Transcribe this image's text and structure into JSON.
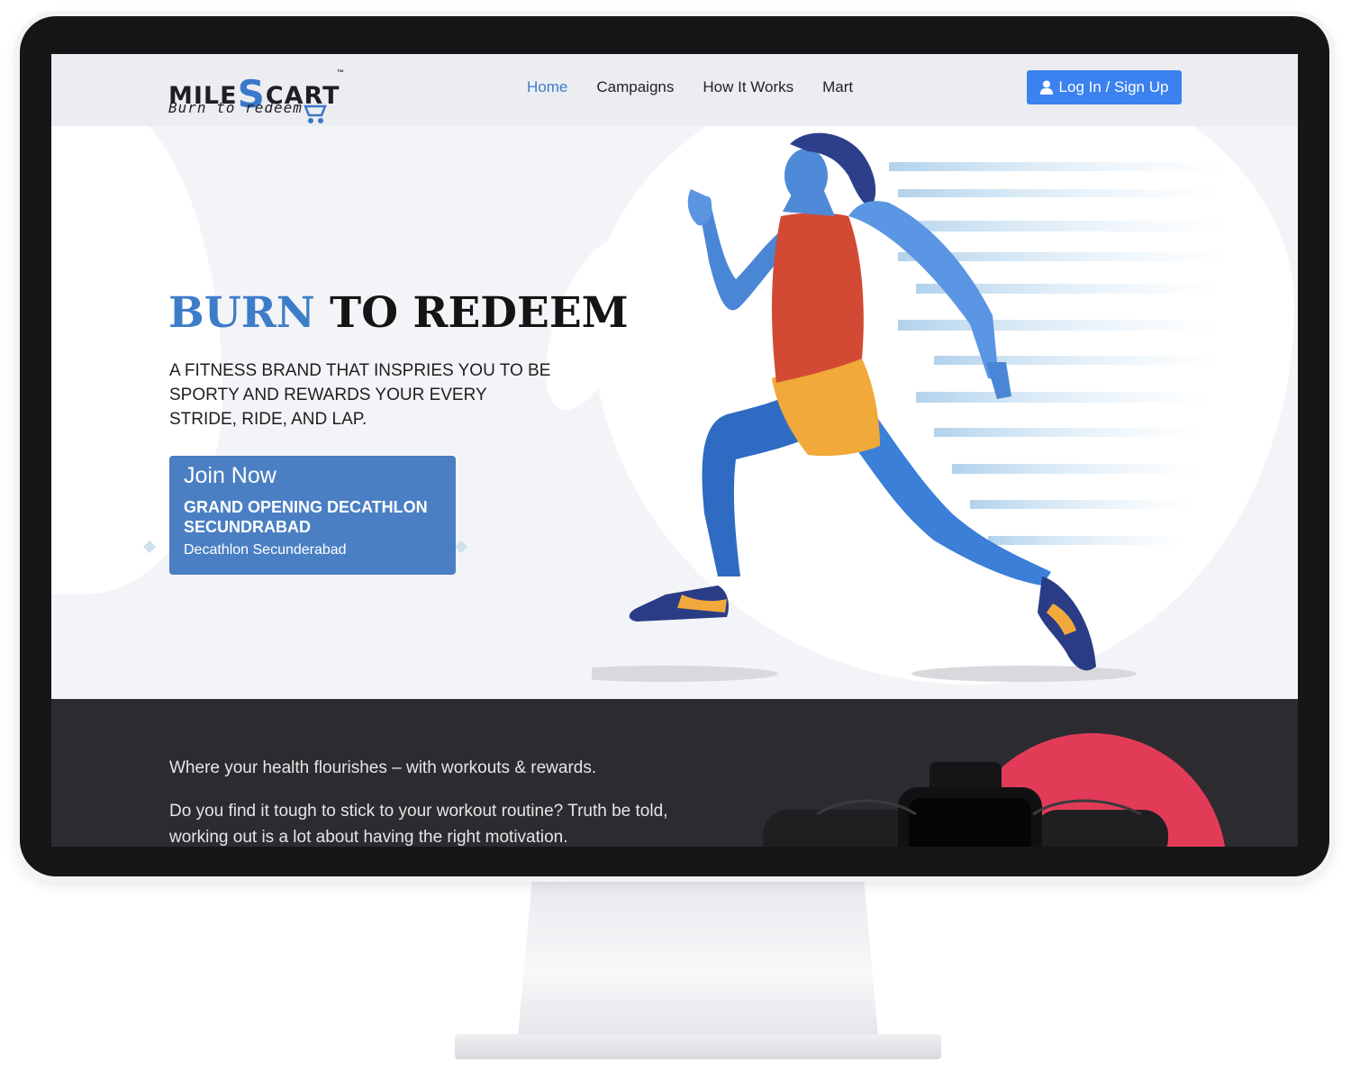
{
  "nav": {
    "logo": {
      "word1": "MILE",
      "letter": "S",
      "word2": "CART",
      "tm": "™",
      "tagline": "Burn to redeem"
    },
    "links": [
      {
        "label": "Home",
        "active": true
      },
      {
        "label": "Campaigns",
        "active": false
      },
      {
        "label": "How It Works",
        "active": false
      },
      {
        "label": "Mart",
        "active": false
      }
    ],
    "login_label": "Log In / Sign Up"
  },
  "hero": {
    "title_accent": "BURN",
    "title_rest": "TO REDEEM",
    "subtitle": "A FITNESS BRAND THAT INSPRIES YOU TO BE SPORTY AND REWARDS YOUR EVERY STRIDE, RIDE, AND LAP.",
    "card": {
      "join_label": "Join Now",
      "event": "GRAND OPENING DECATHLON SECUNDRABAD",
      "location": "Decathlon Secunderabad"
    }
  },
  "about": {
    "line1": "Where your health flourishes – with workouts & rewards.",
    "line2": "Do you find it tough to stick to your workout routine? Truth be told, working out is a lot about having the right motivation."
  },
  "icons": [
    "user-icon",
    "cart-icon",
    "runner-illustration",
    "smartwatch-illustration"
  ],
  "colors": {
    "accent": "#3d7cc9",
    "button": "#3b82f0",
    "card": "#4a7fc3",
    "dark": "#2b2b30",
    "red": "#e23b58"
  }
}
